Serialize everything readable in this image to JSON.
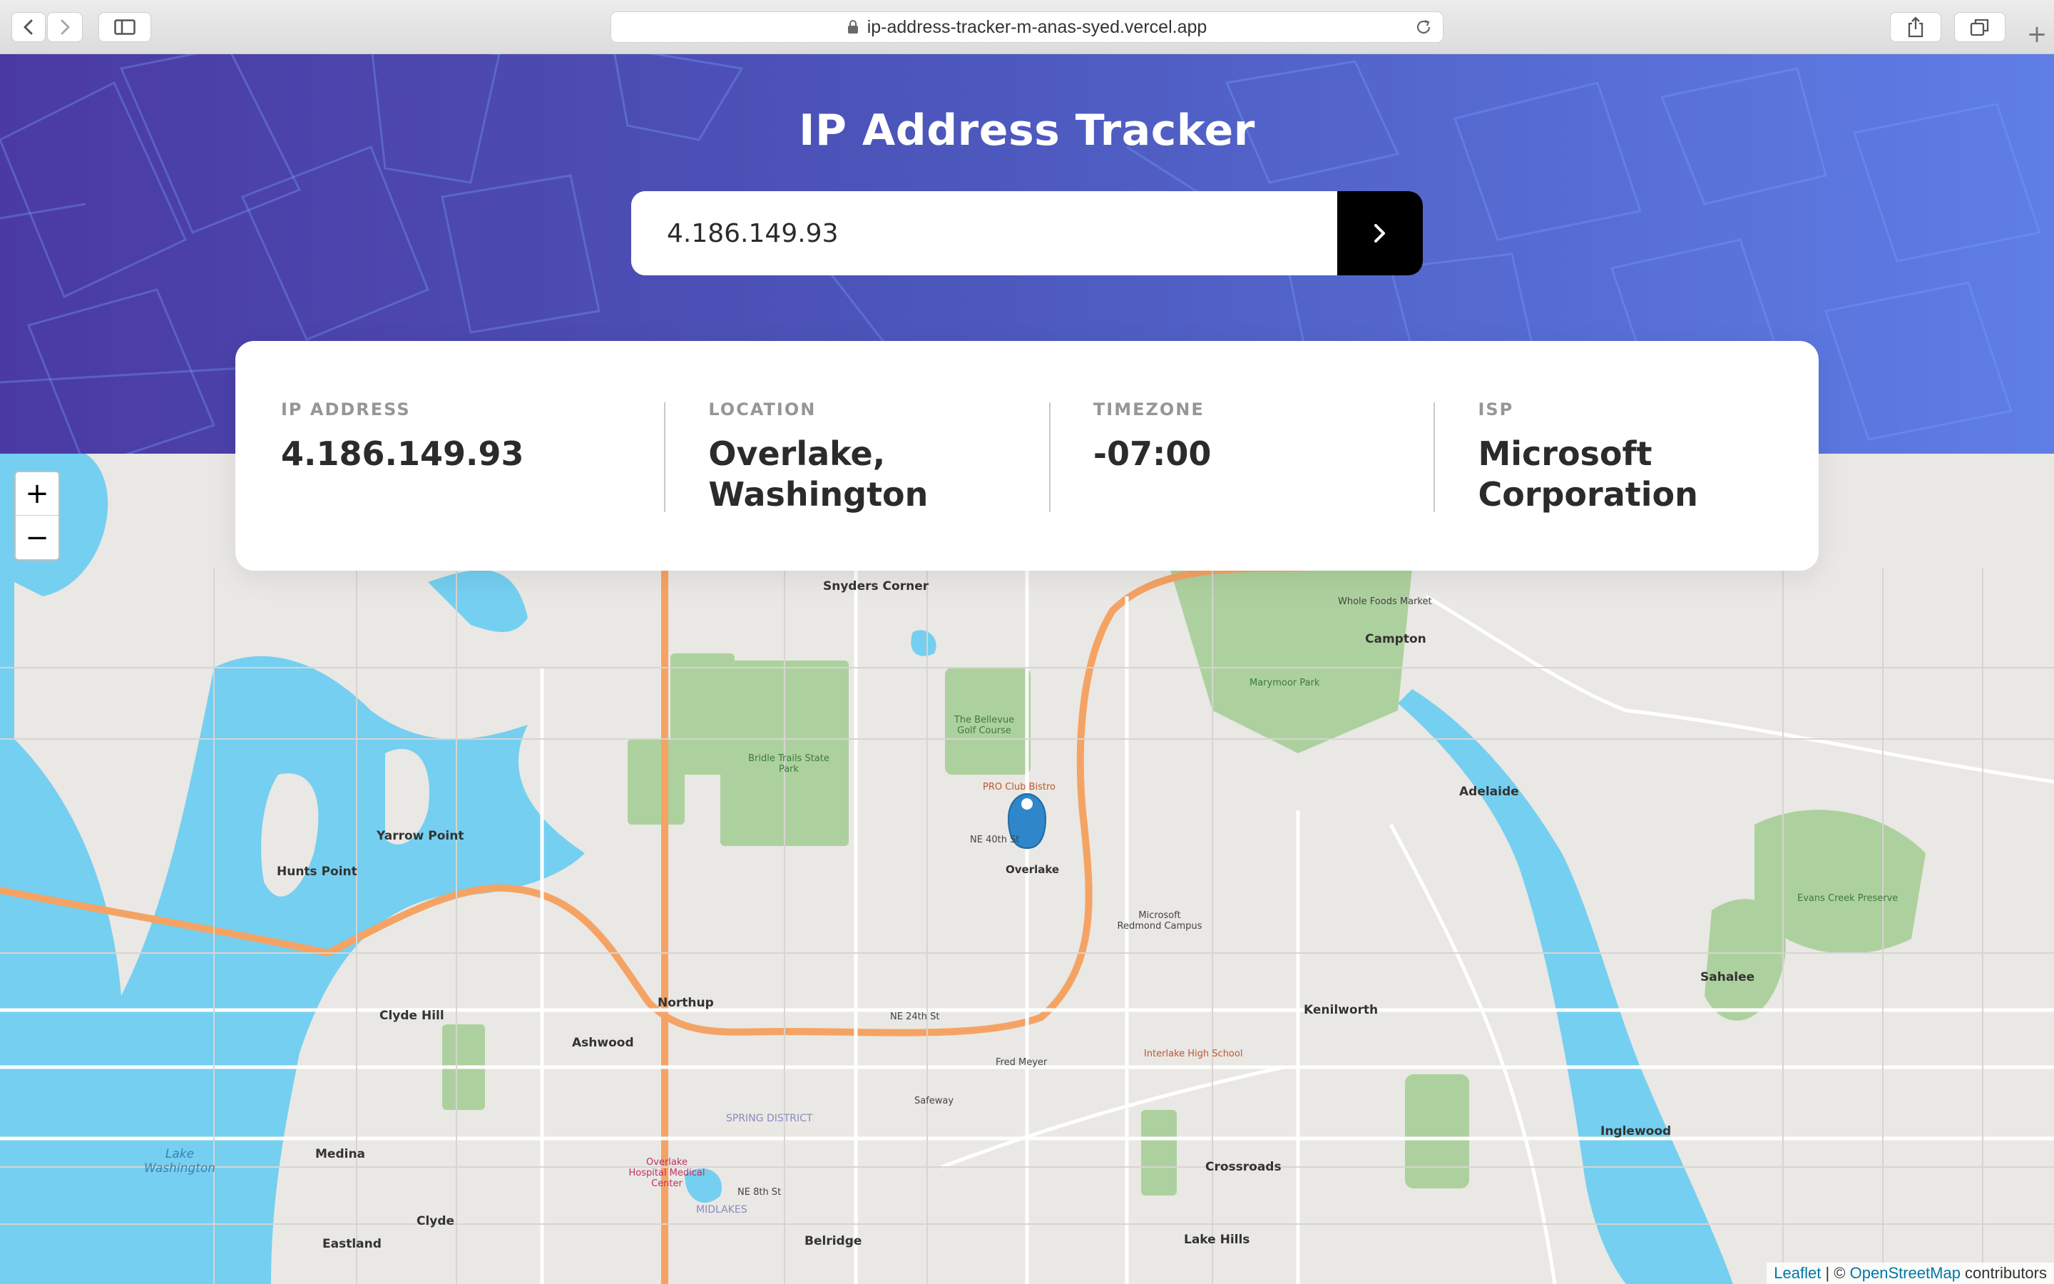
{
  "browser": {
    "url": "ip-address-tracker-m-anas-syed.vercel.app"
  },
  "header": {
    "title": "IP Address Tracker",
    "search_value": "4.186.149.93"
  },
  "info": {
    "ip_label": "IP ADDRESS",
    "ip_value": "4.186.149.93",
    "location_label": "LOCATION",
    "location_value": "Overlake, Washington",
    "timezone_label": "TIMEZONE",
    "timezone_value": "-07:00",
    "isp_label": "ISP",
    "isp_value": "Microsoft Corporation"
  },
  "map": {
    "zoom_in": "+",
    "zoom_out": "−",
    "marker_place": "Overlake",
    "attribution": {
      "leaflet": "Leaflet",
      "separator": " | © ",
      "osm": "OpenStreetMap",
      "suffix": " contributors"
    },
    "labels": {
      "snyders_corner": "Snyders Corner",
      "campton": "Campton",
      "adelaide": "Adelaide",
      "yarrow_point": "Yarrow Point",
      "hunts_point": "Hunts Point",
      "clyde_hill": "Clyde Hill",
      "ashwood": "Ashwood",
      "northup": "Northup",
      "medina": "Medina",
      "clyde": "Clyde",
      "eastland": "Eastland",
      "belridge": "Belridge",
      "crossroads": "Crossroads",
      "lake_hills": "Lake Hills",
      "kenilworth": "Kenilworth",
      "sahalee": "Sahalee",
      "inglewood": "Inglewood",
      "lake_washington": "Lake Washington",
      "bridle_trails": "Bridle Trails State Park",
      "marymoor": "Marymoor Park",
      "evans_creek": "Evans Creek Preserve",
      "microsoft_campus": "Microsoft Redmond Campus",
      "bellevue_golf": "The Bellevue Golf Course",
      "spring_district": "SPRING DISTRICT",
      "midlakes": "MIDLAKES",
      "pro_club": "PRO Club Bistro",
      "fred_meyer": "Fred Meyer",
      "safeway": "Safeway",
      "overlake_hospital": "Overlake Hospital Medical Center",
      "whole_foods": "Whole Foods Market",
      "interlake_school": "Interlake High School",
      "ne_40th": "NE 40th St",
      "ne_24th": "NE 24th St",
      "ne_8th": "NE 8th St"
    }
  }
}
